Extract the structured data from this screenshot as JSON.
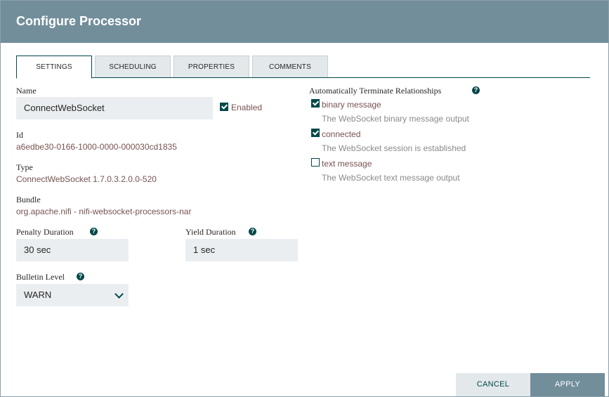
{
  "dialog": {
    "title": "Configure Processor"
  },
  "tabs": [
    {
      "label": "SETTINGS"
    },
    {
      "label": "SCHEDULING"
    },
    {
      "label": "PROPERTIES"
    },
    {
      "label": "COMMENTS"
    }
  ],
  "settings": {
    "name_label": "Name",
    "name_value": "ConnectWebSocket",
    "enabled_label": "Enabled",
    "enabled": true,
    "id_label": "Id",
    "id_value": "a6edbe30-0166-1000-0000-000030cd1835",
    "type_label": "Type",
    "type_value": "ConnectWebSocket 1.7.0.3.2.0.0-520",
    "bundle_label": "Bundle",
    "bundle_value": "org.apache.nifi - nifi-websocket-processors-nar",
    "penalty_label": "Penalty Duration",
    "penalty_value": "30 sec",
    "yield_label": "Yield Duration",
    "yield_value": "1 sec",
    "bulletin_label": "Bulletin Level",
    "bulletin_value": "WARN"
  },
  "relationships": {
    "heading": "Automatically Terminate Relationships",
    "items": [
      {
        "name": "binary message",
        "description": "The WebSocket binary message output",
        "checked": true
      },
      {
        "name": "connected",
        "description": "The WebSocket session is established",
        "checked": true
      },
      {
        "name": "text message",
        "description": "The WebSocket text message output",
        "checked": false
      }
    ]
  },
  "help_glyph": "?",
  "buttons": {
    "cancel": "CANCEL",
    "apply": "APPLY"
  },
  "colors": {
    "header": "#728e9b",
    "accent": "#004849",
    "value": "#775351"
  }
}
